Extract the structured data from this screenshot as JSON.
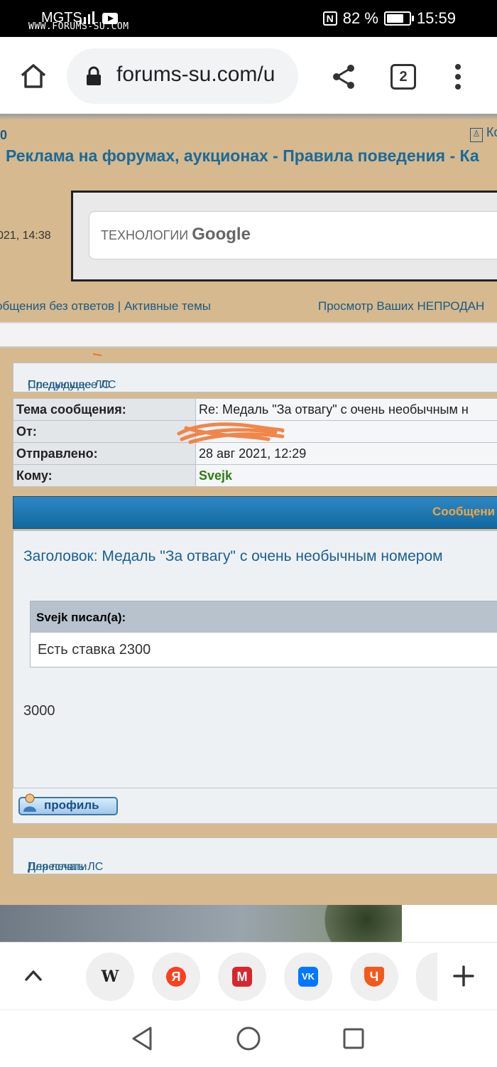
{
  "status_bar": {
    "carrier": "MGTS",
    "watermark": "WWW.FORUMS-SU.COM",
    "battery": "82 %",
    "battery_level": 0.82,
    "time": "15:59"
  },
  "browser": {
    "url": "forums-su.com/u",
    "tab_count": "2"
  },
  "forum": {
    "top_left_fragment": "0",
    "top_right_fragment": "Ко",
    "top_nav": "Реклама на форумах, аукционах - Правила поведения - Ка",
    "date_fragment": "021, 14:38",
    "ad_text": "ТЕХНОЛОГИИ",
    "ad_brand": "Google",
    "nav_left_1": "общения без ответов",
    "nav_sep": " | ",
    "nav_left_2": "Активные темы",
    "nav_right": "Просмотр Ваших НЕПРОДАН",
    "prev_pm": "Предыдущее ЛС",
    "next_pm": "Следующее ЛС",
    "header_rows": [
      {
        "label": "Тема сообщения:",
        "value": "Re: Медаль \"За отвагу\" с очень необычным н"
      },
      {
        "label": "От:",
        "value": ""
      },
      {
        "label": "Отправлено:",
        "value": "28 авг 2021, 12:29"
      },
      {
        "label": "Кому:",
        "value": "Svejk"
      }
    ],
    "message_bar_label": "Сообщени",
    "subject": "Заголовок: Медаль \"За отвагу\" с очень необычным номером",
    "quote_author": "Svejk писал(а):",
    "quote_text": "Есть ставка 2300",
    "reply_text": "3000",
    "profile_button": "профиль",
    "print_link": "Для печати",
    "forward_link": "Переслать ЛС"
  },
  "bookmarks": [
    {
      "name": "wikipedia",
      "glyph": "W",
      "color": "#ffffff"
    },
    {
      "name": "yandex",
      "glyph": "Я",
      "color": "#fc3f1d"
    },
    {
      "name": "marketplace",
      "glyph": "M",
      "color": "#ffffff"
    },
    {
      "name": "vk",
      "glyph": "VK",
      "color": "#0077ff"
    },
    {
      "name": "chitai-gorod",
      "glyph": "Ч",
      "color": "#f25a1d"
    }
  ],
  "colors": {
    "forum_bg": "#d6b98e",
    "link": "#1a5a86",
    "recipient": "#2e7d14",
    "header_orange": "#f0a646"
  }
}
